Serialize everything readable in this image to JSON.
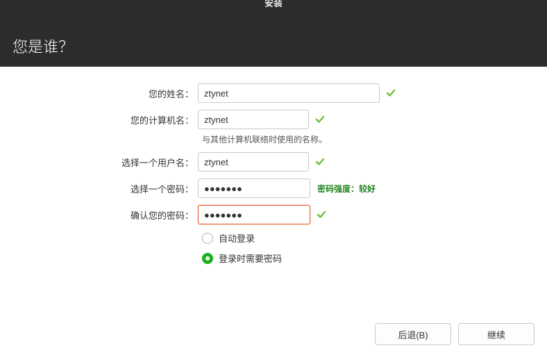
{
  "window": {
    "title": "安装"
  },
  "heading": "您是谁？",
  "labels": {
    "fullname": "您的姓名：",
    "hostname": "您的计算机名：",
    "username": "选择一个用户名：",
    "password": "选择一个密码：",
    "confirm": "确认您的密码："
  },
  "values": {
    "fullname": "ztynet",
    "hostname": "ztynet",
    "username": "ztynet",
    "password": "●●●●●●●",
    "confirm": "●●●●●●●"
  },
  "hint_hostname": "与其他计算机联络时使用的名称。",
  "password_strength": "密码强度：较好",
  "radios": {
    "auto": "自动登录",
    "require": "登录时需要密码"
  },
  "buttons": {
    "back": "后退(B)",
    "continue": "继续"
  }
}
